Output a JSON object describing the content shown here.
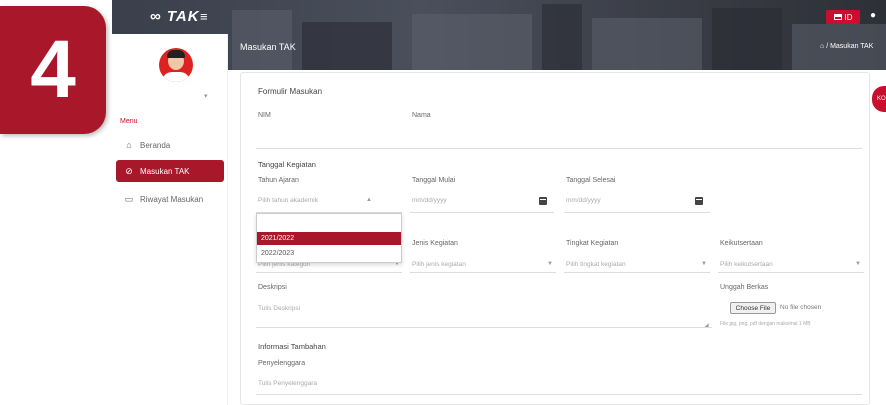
{
  "step_badge": "4",
  "header": {
    "logo": "TAK",
    "lang": "ID",
    "page_title": "Masukan TAK",
    "breadcrumb": "/ Masukan TAK"
  },
  "sidebar": {
    "menu_label": "Menu",
    "items": [
      {
        "label": "Beranda",
        "icon": "home-icon"
      },
      {
        "label": "Masukan TAK",
        "icon": "check-circle-icon"
      },
      {
        "label": "Riwayat Masukan",
        "icon": "folder-icon"
      }
    ]
  },
  "form": {
    "title": "Formulir Masukan",
    "nim_label": "NIM",
    "nama_label": "Nama",
    "section_tanggal": "Tanggal Kegiatan",
    "tahun_ajaran_label": "Tahun Ajaran",
    "tahun_ajaran_placeholder": "Pilih tahun akademik",
    "tanggal_mulai_label": "Tanggal Mulai",
    "tanggal_mulai_placeholder": "mm/dd/yyyy",
    "tanggal_selesai_label": "Tanggal Selesai",
    "tanggal_selesai_placeholder": "mm/dd/yyyy",
    "dropdown_options": [
      "2021/2022",
      "2022/2023"
    ],
    "jenis_kegiatan_label": "Jenis Kegiatan",
    "jenis_kegiatan_placeholder": "Pilih jenis kegiatan",
    "left_hidden_placeholder": "Pilih jenis kategori",
    "tingkat_label": "Tingkat Kegiatan",
    "tingkat_placeholder": "Pilih tingkat kegiatan",
    "keikutsertaan_label": "Keikutsertaan",
    "keikutsertaan_placeholder": "Pilih keikutsertaan",
    "deskripsi_label": "Deskripsi",
    "deskripsi_placeholder": "Tulis Deskripsi",
    "unggah_label": "Unggah Berkas",
    "file_button": "Choose File",
    "file_status": "No file chosen",
    "file_hint": "File jpg, png, pdf dengan maksimal 1 MB",
    "section_info": "Informasi Tambahan",
    "penyelenggara_label": "Penyelenggara",
    "penyelenggara_placeholder": "Tulis Penyelenggara"
  },
  "colors": {
    "accent": "#a8182a",
    "banner": "#3e424d"
  }
}
